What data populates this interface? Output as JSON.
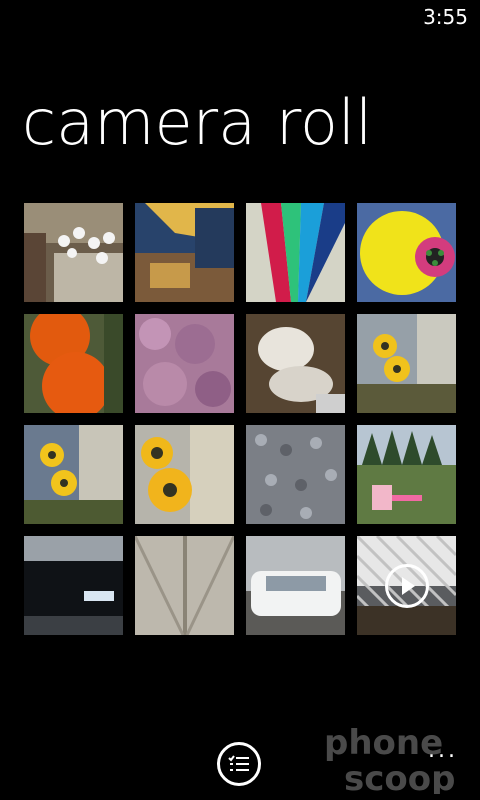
{
  "status_bar": {
    "time": "3:55"
  },
  "page": {
    "title": "camera roll"
  },
  "tiles": [
    {
      "name": "flowers-basket"
    },
    {
      "name": "cafe-painting"
    },
    {
      "name": "kite-sail"
    },
    {
      "name": "yellow-toy"
    },
    {
      "name": "pumpkins"
    },
    {
      "name": "heather-flowers"
    },
    {
      "name": "statue-garden"
    },
    {
      "name": "black-eyed-susans"
    },
    {
      "name": "yellow-flowers-wall"
    },
    {
      "name": "sunflowers-closeup"
    },
    {
      "name": "gravel-stones"
    },
    {
      "name": "backyard-playset"
    },
    {
      "name": "black-car"
    },
    {
      "name": "barn-doors"
    },
    {
      "name": "white-car"
    },
    {
      "name": "video-lattice",
      "is_video": true
    }
  ],
  "app_bar": {
    "more_label": "..."
  },
  "watermark": {
    "line1": "phone",
    "line2": "scoop"
  }
}
